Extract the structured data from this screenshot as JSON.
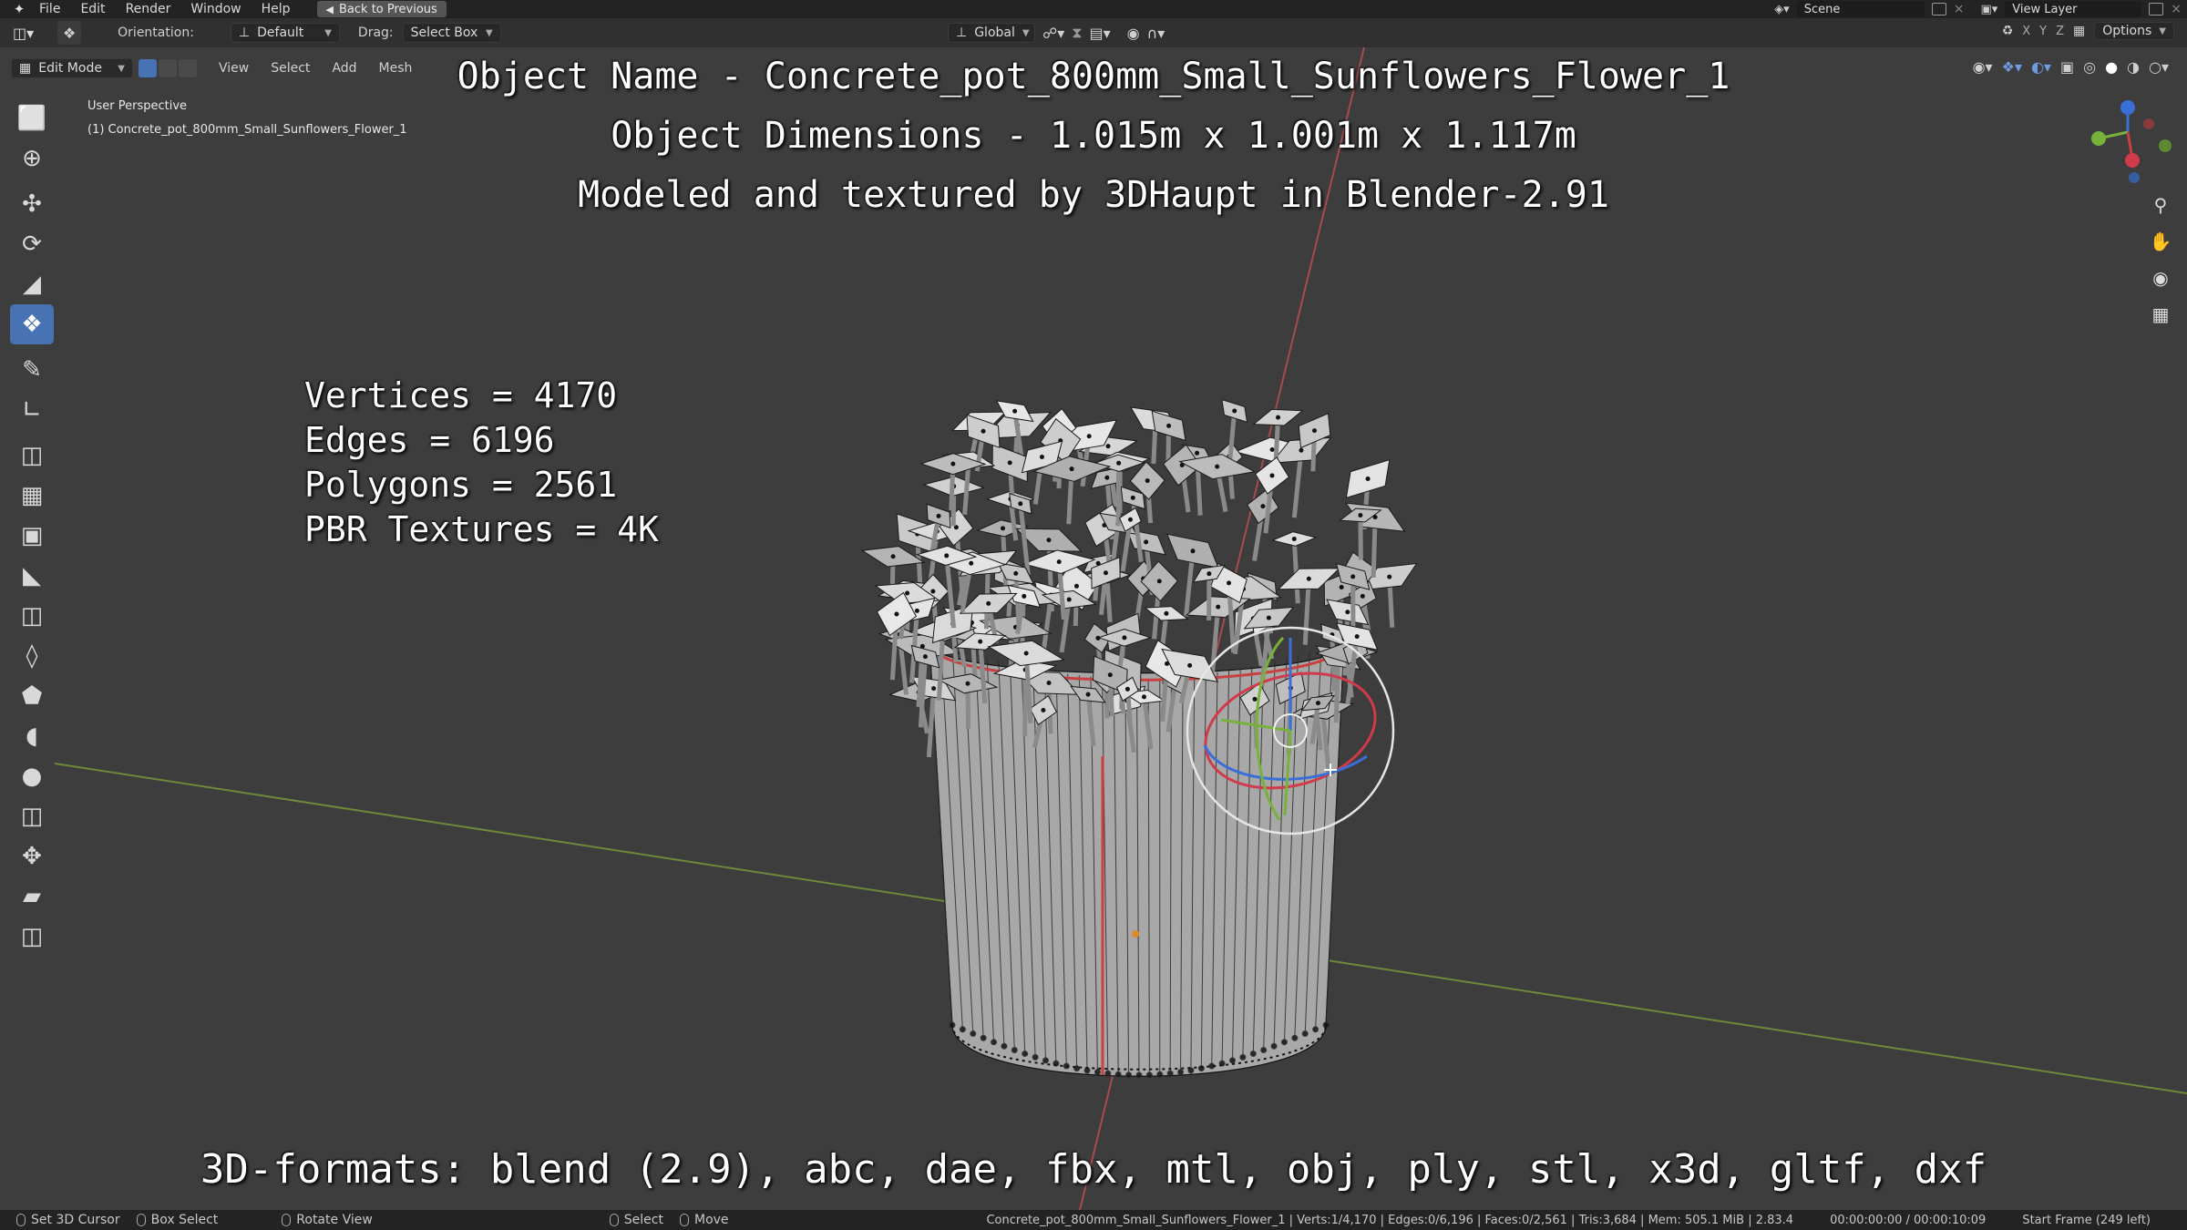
{
  "menubar": {
    "items": [
      "File",
      "Edit",
      "Render",
      "Window",
      "Help"
    ],
    "back_button": "Back to Previous",
    "scene_name": "Scene",
    "view_layer": "View Layer"
  },
  "toolheader": {
    "orientation_label": "Orientation:",
    "orientation_value": "Default",
    "drag_label": "Drag:",
    "drag_value": "Select Box",
    "transform_orientation": "Global",
    "axes": [
      "X",
      "Y",
      "Z"
    ],
    "options_label": "Options"
  },
  "viewheader": {
    "mode": "Edit Mode",
    "items": [
      "View",
      "Select",
      "Add",
      "Mesh"
    ]
  },
  "viewport_info": {
    "perspective": "User Perspective",
    "object": "(1) Concrete_pot_800mm_Small_Sunflowers_Flower_1"
  },
  "overlay": {
    "title_lines": [
      "Object Name - Concrete_pot_800mm_Small_Sunflowers_Flower_1",
      "Object Dimensions -  1.015m x 1.001m x 1.117m",
      "Modeled and textured by 3DHaupt in Blender-2.91"
    ],
    "stats": [
      "Vertices = 4170",
      "Edges = 6196",
      "Polygons = 2561",
      "PBR Textures = 4K"
    ],
    "formats": "3D-formats: blend (2.9), abc, dae, fbx, mtl, obj, ply, stl, x3d, gltf, dxf"
  },
  "toolbar": {
    "tools": [
      "select-box",
      "cursor",
      "move",
      "rotate",
      "scale",
      "transform",
      "annotate",
      "measure",
      "add-cube",
      "extrude",
      "inset",
      "bevel",
      "loop-cut",
      "knife",
      "poly-build",
      "spin",
      "smooth",
      "edge-slide",
      "shrink-fatten",
      "shear",
      "rip-region"
    ],
    "active_index": 5
  },
  "statusbar": {
    "items": [
      {
        "label": "Set 3D Cursor"
      },
      {
        "label": "Box Select"
      },
      {
        "label": "Rotate View"
      },
      {
        "label": "Select"
      },
      {
        "label": "Move"
      }
    ],
    "stats": "Concrete_pot_800mm_Small_Sunflowers_Flower_1 | Verts:1/4,170 | Edges:0/6,196 | Faces:0/2,561 | Tris:3,684 | Mem: 505.1 MiB | 2.83.4",
    "time": "00:00:00:00 / 00:00:10:09",
    "frame": "Start Frame (249 left)"
  },
  "colors": {
    "viewport_bg": "#3d3d3d",
    "accent": "#4772b3",
    "x_axis": "#c0494d",
    "y_axis": "#76a127"
  }
}
